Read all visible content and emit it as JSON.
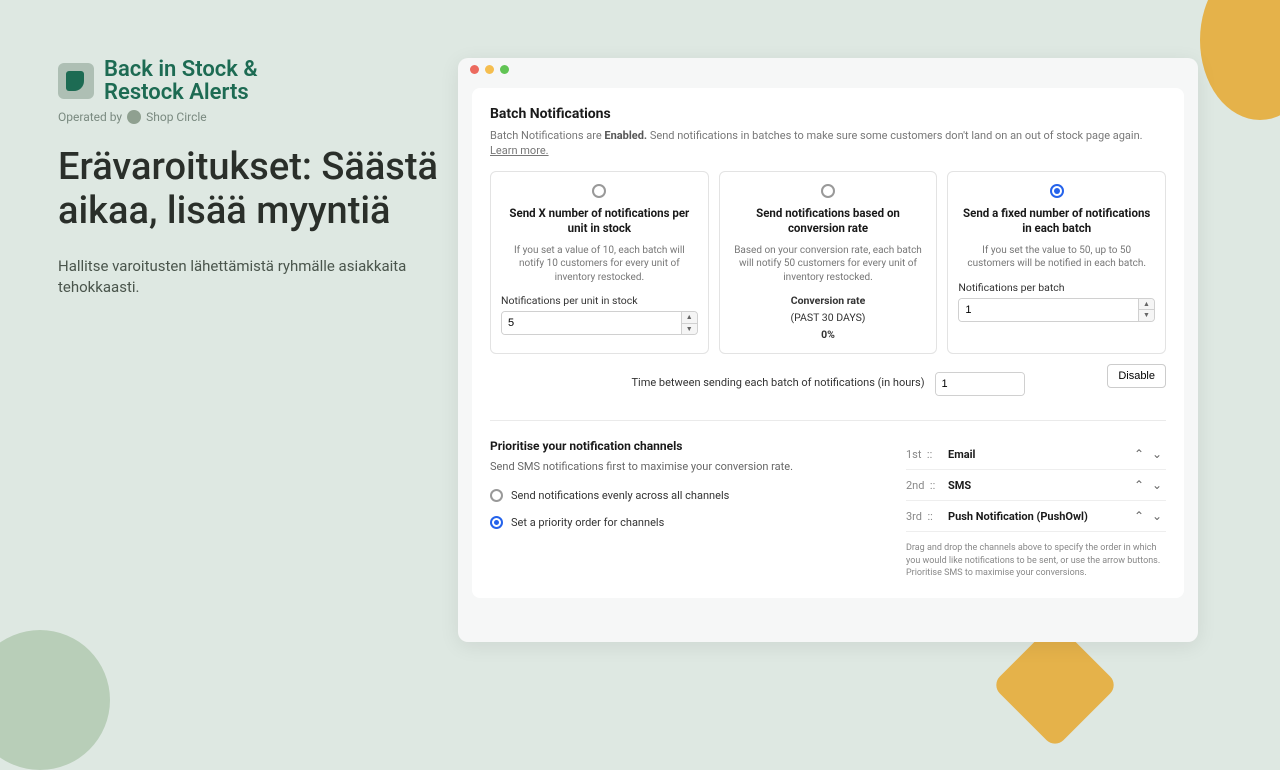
{
  "brand": {
    "line1": "Back in Stock &",
    "line2": "Restock Alerts",
    "operated_by": "Operated by",
    "shop_circle": "Shop Circle"
  },
  "headline": "Erävaroitukset: Säästä aikaa, lisää myyntiä",
  "subhead": "Hallitse varoitusten lähettämistä ryhmälle asiakkaita tehokkaasti.",
  "batch": {
    "title": "Batch Notifications",
    "desc_prefix": "Batch Notifications are",
    "desc_strong": "Enabled.",
    "desc_rest": "Send notifications in batches to make sure some customers don't land on an out of stock page again.",
    "learn_more": "Learn more.",
    "disable_btn": "Disable"
  },
  "options": [
    {
      "title": "Send X number of notifications per unit in stock",
      "desc": "If you set a value of 10, each batch will notify 10 customers for every unit of inventory restocked.",
      "field_label": "Notifications per unit in stock",
      "value": "5"
    },
    {
      "title": "Send notifications based on conversion rate",
      "desc": "Based on your conversion rate, each batch will notify 50 customers for every unit of inventory restocked.",
      "rate_label": "Conversion rate",
      "rate_period": "(PAST 30 DAYS)",
      "rate_value": "0%"
    },
    {
      "title": "Send a fixed number of notifications in each batch",
      "desc": "If you set the value to 50, up to 50 customers will be notified in each batch.",
      "field_label": "Notifications per batch",
      "value": "1"
    }
  ],
  "time_between": {
    "label": "Time between sending each batch of notifications (in hours)",
    "value": "1"
  },
  "priority": {
    "title": "Prioritise your notification channels",
    "desc": "Send SMS notifications first to maximise your conversion rate.",
    "option_even": "Send notifications evenly across all channels",
    "option_order": "Set a priority order for channels",
    "channels": [
      {
        "pos": "1st",
        "name": "Email"
      },
      {
        "pos": "2nd",
        "name": "SMS"
      },
      {
        "pos": "3rd",
        "name": "Push Notification (PushOwl)"
      }
    ],
    "hint": "Drag and drop the channels above to specify the order in which you would like notifications to be sent, or use the arrow buttons. Prioritise SMS to maximise your conversions."
  }
}
